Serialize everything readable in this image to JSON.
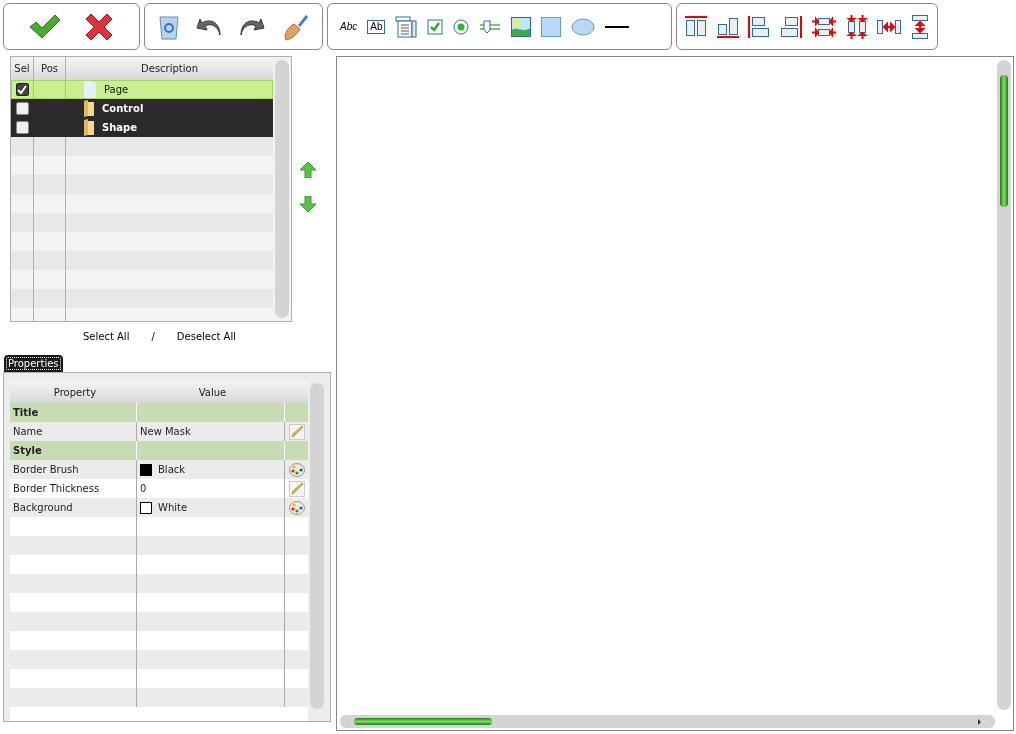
{
  "toolbar": {
    "text_tool_label": "Abc",
    "textbox_tool_label": "Ab"
  },
  "object_list": {
    "columns": [
      "Sel",
      "Pos",
      "Description"
    ],
    "rows": [
      {
        "label": "Page",
        "kind": "page",
        "checked": true,
        "selected": true
      },
      {
        "label": "Control",
        "kind": "folder",
        "checked": false,
        "selected": false
      },
      {
        "label": "Shape",
        "kind": "folder",
        "checked": false,
        "selected": false
      }
    ],
    "select_all": "Select All",
    "separator": "/",
    "deselect_all": "Deselect All"
  },
  "properties_tab": {
    "label": "Properties",
    "selected": true
  },
  "properties": {
    "columns": [
      "Property",
      "Value"
    ],
    "rows": [
      {
        "kind": "section",
        "name": "Title"
      },
      {
        "kind": "text_property",
        "name": "Name",
        "value": "New Mask"
      },
      {
        "kind": "section",
        "name": "Style"
      },
      {
        "kind": "color_property",
        "name": "Border Brush",
        "value": "Black",
        "color": "#000000"
      },
      {
        "kind": "text_property",
        "name": "Border Thickness",
        "value": "0"
      },
      {
        "kind": "color_property",
        "name": "Background",
        "value": "White",
        "color": "#ffffff"
      }
    ]
  }
}
